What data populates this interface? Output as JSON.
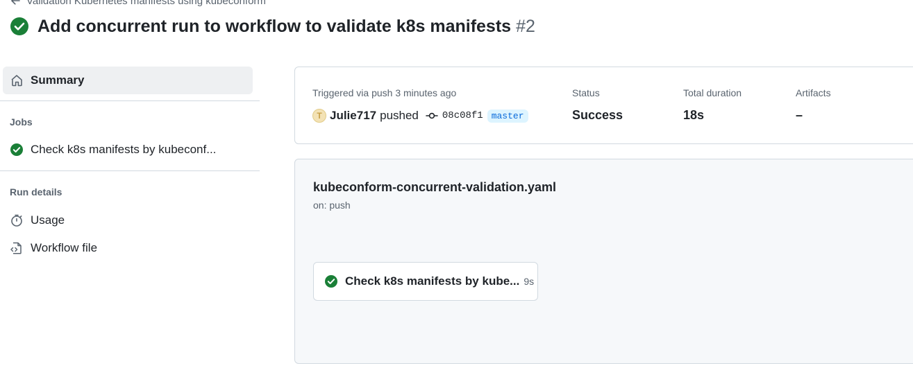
{
  "header": {
    "back_link": "Validation Kubernetes manifests using kubeconform",
    "title": "Add concurrent run to workflow to validate k8s manifests",
    "run_number": "#2"
  },
  "sidebar": {
    "summary_label": "Summary",
    "jobs_heading": "Jobs",
    "jobs": [
      {
        "label": "Check k8s manifests by kubeconf..."
      }
    ],
    "run_details_heading": "Run details",
    "run_details": [
      {
        "label": "Usage",
        "icon": "stopwatch-icon"
      },
      {
        "label": "Workflow file",
        "icon": "file-code-icon"
      }
    ]
  },
  "summary": {
    "triggered_text": "Triggered via push 3 minutes ago",
    "actor": "Julie717",
    "avatar_letter": "T",
    "action": "pushed",
    "commit_sha": "08c08f1",
    "branch": "master",
    "status_label": "Status",
    "status_value": "Success",
    "duration_label": "Total duration",
    "duration_value": "18s",
    "artifacts_label": "Artifacts",
    "artifacts_value": "–"
  },
  "workflow": {
    "file_name": "kubeconform-concurrent-validation.yaml",
    "trigger": "on: push",
    "job_name": "Check k8s manifests by kube...",
    "job_duration": "9s"
  },
  "colors": {
    "success": "#1a7f37",
    "muted": "#59636e",
    "border": "#d1d9e0",
    "branch_bg": "#ddf4ff",
    "branch_fg": "#0969da"
  }
}
